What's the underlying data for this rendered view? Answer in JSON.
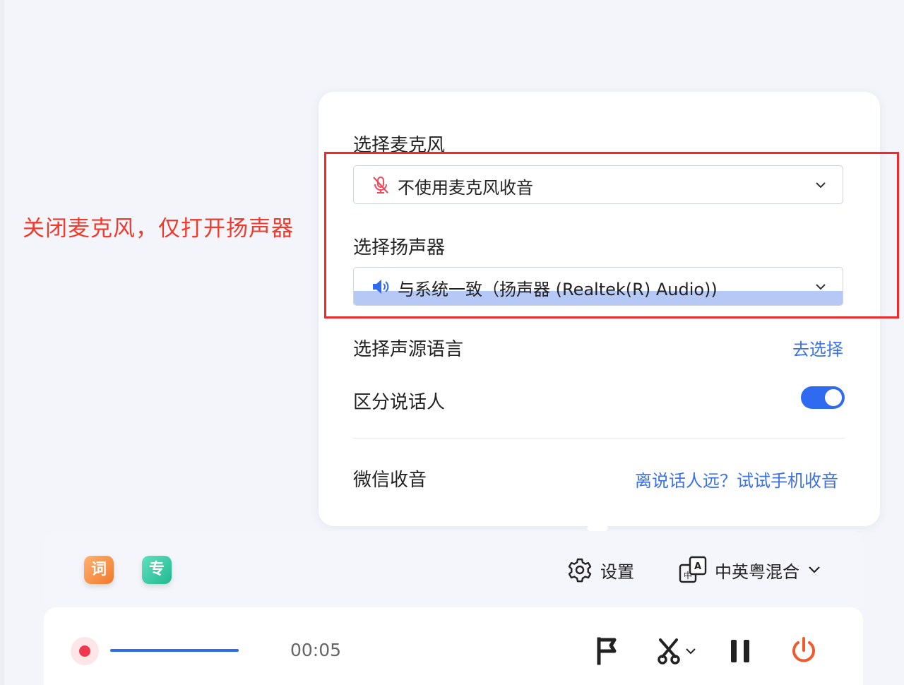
{
  "annotation": {
    "text": "关闭麦克风，仅打开扬声器",
    "color": "#f03a2c"
  },
  "settings_panel": {
    "microphone": {
      "label": "选择麦克风",
      "selected": "不使用麦克风收音",
      "icon": "mic-off-icon"
    },
    "speaker": {
      "label": "选择扬声器",
      "selected": "与系统一致（扬声器 (Realtek(R) Audio))",
      "icon": "speaker-icon"
    },
    "source_language": {
      "label": "选择声源语言",
      "action": "去选择"
    },
    "speaker_diarization": {
      "label": "区分说话人",
      "enabled": true
    },
    "wechat_capture": {
      "label": "微信收音",
      "link": "离说话人远？试试手机收音"
    }
  },
  "toolbar": {
    "tag_vocab": "词",
    "tag_pro": "专",
    "settings_label": "设置",
    "language_mode": "中英粤混合"
  },
  "recorder": {
    "elapsed": "00:05"
  },
  "colors": {
    "accent": "#2f6bf0",
    "link": "#3d72e6",
    "record": "#f0394f",
    "power": "#f05a2c",
    "highlight_border": "#ee2a2a"
  }
}
